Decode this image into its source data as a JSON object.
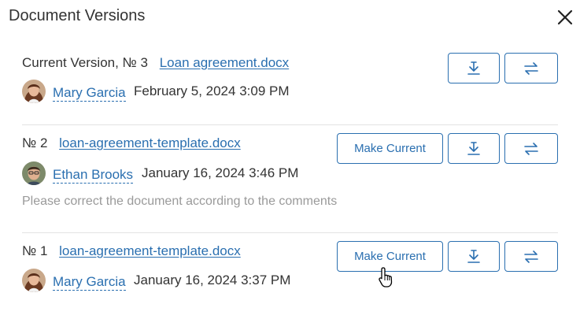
{
  "dialog": {
    "title": "Document Versions",
    "close_icon": "close-icon"
  },
  "versions": [
    {
      "label": "Current Version, № 3",
      "file_name": "Loan agreement.docx",
      "author": "Mary Garcia",
      "date": "February 5, 2024 3:09 PM",
      "comment": "",
      "show_make_current": false
    },
    {
      "label": "№ 2",
      "file_name": "loan-agreement-template.docx",
      "author": "Ethan Brooks",
      "date": "January 16, 2024 3:46 PM",
      "comment": "Please correct the document according to the comments",
      "show_make_current": true
    },
    {
      "label": "№ 1",
      "file_name": "loan-agreement-template.docx",
      "author": "Mary Garcia",
      "date": "January 16, 2024 3:37 PM",
      "comment": "",
      "show_make_current": true
    }
  ],
  "buttons": {
    "make_current_label": "Make Current",
    "download_icon": "download-icon",
    "compare_icon": "compare-arrows-icon"
  },
  "colors": {
    "accent": "#2a6fb0",
    "text": "#333333",
    "muted": "#9a9a9a",
    "divider": "#e3e3e3"
  }
}
